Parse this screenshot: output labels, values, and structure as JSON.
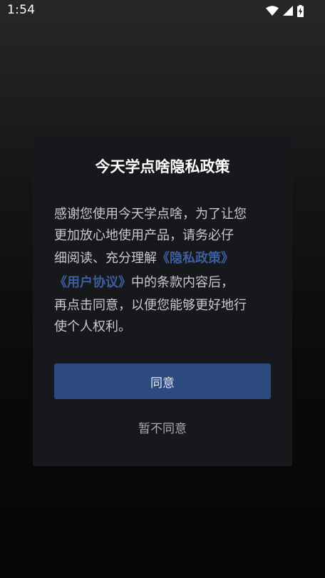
{
  "status_bar": {
    "time": "1:54",
    "icons": [
      "wifi-icon",
      "cellular-signal-icon",
      "battery-charging-icon"
    ]
  },
  "dialog": {
    "title": "今天学点啥隐私政策",
    "body": {
      "line1": "感谢您使用今天学点啥，为了让您",
      "line2": "更加放心地使用产品，请务必仔",
      "line3_text": "细阅读、充分理解",
      "privacy_link": "《隐私政策》",
      "user_agreement_link": "《用户协议》",
      "line4_text": "中的条款内容后，",
      "line5": "再点击同意，以便您能够更好地行",
      "line6": "使个人权利。"
    },
    "agree_label": "同意",
    "disagree_label": "暂不同意"
  },
  "colors": {
    "dialog_bg": "#17181b",
    "primary_button": "#2c4a80",
    "link": "#3d5d9e",
    "body_text": "#c9cace"
  }
}
